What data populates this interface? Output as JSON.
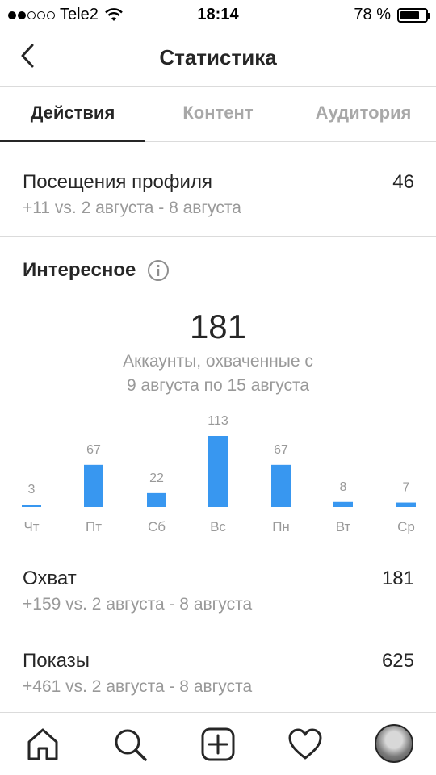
{
  "status_bar": {
    "carrier": "Tele2",
    "time": "18:14",
    "battery": "78 %",
    "battery_level": 0.78,
    "signal_bars": 2
  },
  "header": {
    "title": "Статистика"
  },
  "tabs": [
    {
      "label": "Действия",
      "active": true
    },
    {
      "label": "Контент",
      "active": false
    },
    {
      "label": "Аудитория",
      "active": false
    }
  ],
  "profile_visits": {
    "label": "Посещения профиля",
    "value": "46",
    "comparison": "+11 vs. 2 августа - 8 августа"
  },
  "discovery": {
    "title": "Интересное",
    "total": "181",
    "caption_line1": "Аккаунты, охваченные с",
    "caption_line2": "9 августа по 15 августа"
  },
  "chart_data": {
    "type": "bar",
    "categories": [
      "Чт",
      "Пт",
      "Сб",
      "Вс",
      "Пн",
      "Вт",
      "Ср"
    ],
    "values": [
      3,
      67,
      22,
      113,
      67,
      8,
      7
    ],
    "bar_color": "#3897f0"
  },
  "reach": {
    "label": "Охват",
    "value": "181",
    "comparison": "+159 vs. 2 августа - 8 августа"
  },
  "impressions": {
    "label": "Показы",
    "value": "625",
    "comparison": "+461 vs. 2 августа - 8 августа"
  },
  "nav": {
    "icons": [
      "home-icon",
      "search-icon",
      "add-icon",
      "heart-icon",
      "profile-avatar"
    ]
  }
}
